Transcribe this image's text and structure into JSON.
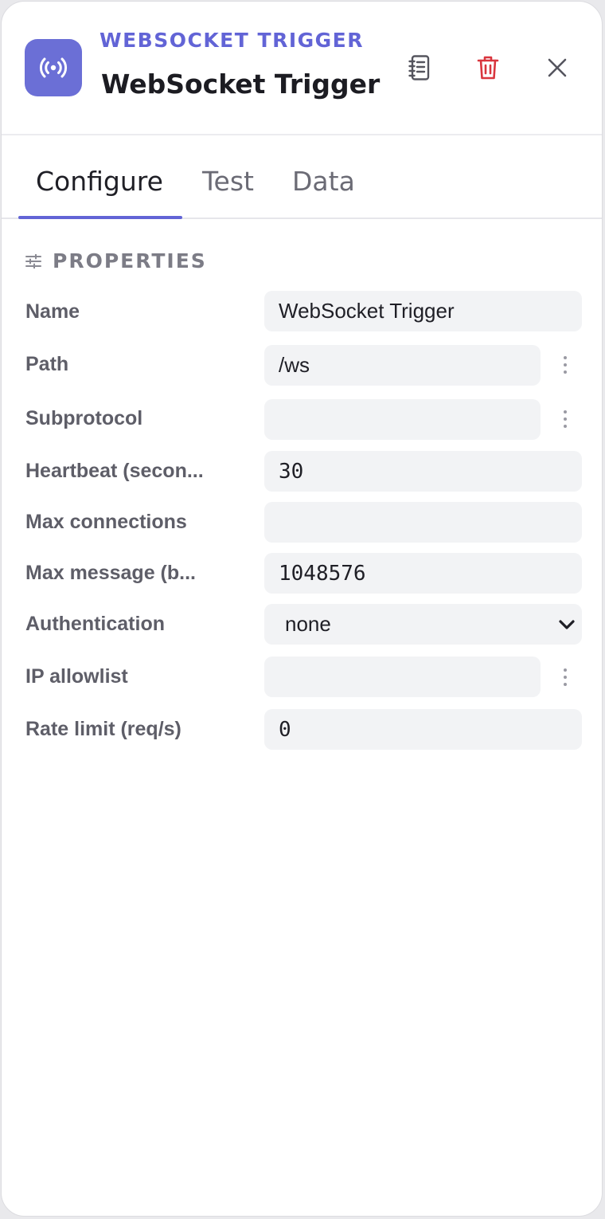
{
  "header": {
    "kind": "WEBSOCKET TRIGGER",
    "title": "WebSocket Trigger",
    "node_icon": "broadcast-icon",
    "docs_icon": "notebook-icon",
    "delete_icon": "trash-icon",
    "close_icon": "close-icon",
    "accent_color": "#6264d6",
    "delete_color": "#d9363e"
  },
  "tabs": {
    "configure": "Configure",
    "test": "Test",
    "data": "Data",
    "active": "Configure"
  },
  "properties": {
    "section_title": "PROPERTIES",
    "name": {
      "label": "Name",
      "value": "WebSocket Trigger"
    },
    "path": {
      "label": "Path",
      "value": "/ws"
    },
    "subprotocol": {
      "label": "Subprotocol",
      "value": ""
    },
    "heartbeat": {
      "label": "Heartbeat (secon...",
      "value": "30"
    },
    "max_connections": {
      "label": "Max connections",
      "value": ""
    },
    "max_message": {
      "label": "Max message (b...",
      "value": "1048576"
    },
    "authentication": {
      "label": "Authentication",
      "value": "none"
    },
    "ip_allowlist": {
      "label": "IP allowlist",
      "value": ""
    },
    "rate_limit": {
      "label": "Rate limit (req/s)",
      "value": "0"
    }
  }
}
